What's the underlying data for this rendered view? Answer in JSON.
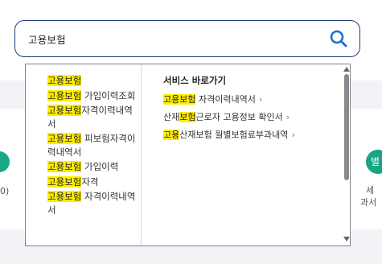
{
  "search": {
    "value": "고용보험",
    "button_icon": "search-icon",
    "accent_color": "#1f6fd6"
  },
  "suggestions": [
    {
      "hl": "고용보험",
      "rest": ""
    },
    {
      "hl": "고용보험",
      "rest": " 가입이력조회"
    },
    {
      "hl": "고용보험",
      "rest": "자격이력내역서"
    },
    {
      "hl": "고용보험",
      "rest": " 피보험자격이력내역서"
    },
    {
      "hl": "고용보험",
      "rest": " 가입이력"
    },
    {
      "hl": "고용보험",
      "rest": "자격"
    },
    {
      "hl": "고용보험",
      "rest": " 자격이력내역서"
    }
  ],
  "services": {
    "title": "서비스 바로가기",
    "links": [
      {
        "pre": "",
        "hl": "고용보험",
        "post": " 자격이력내역서"
      },
      {
        "pre": "산재",
        "hl": "보험",
        "post": "근로자 고용정보 확인서"
      },
      {
        "pre": "",
        "hl": "고용",
        "post": "산재보험 월별보험료부과내역"
      }
    ],
    "arrow": "›"
  },
  "background": {
    "left_label": "0)",
    "right_icon_text": "별",
    "right_label_1": "세",
    "right_label_2": "과서"
  },
  "colors": {
    "highlight": "#ffee00",
    "search_border": "#1f3b78",
    "icon_green": "#18a886"
  }
}
